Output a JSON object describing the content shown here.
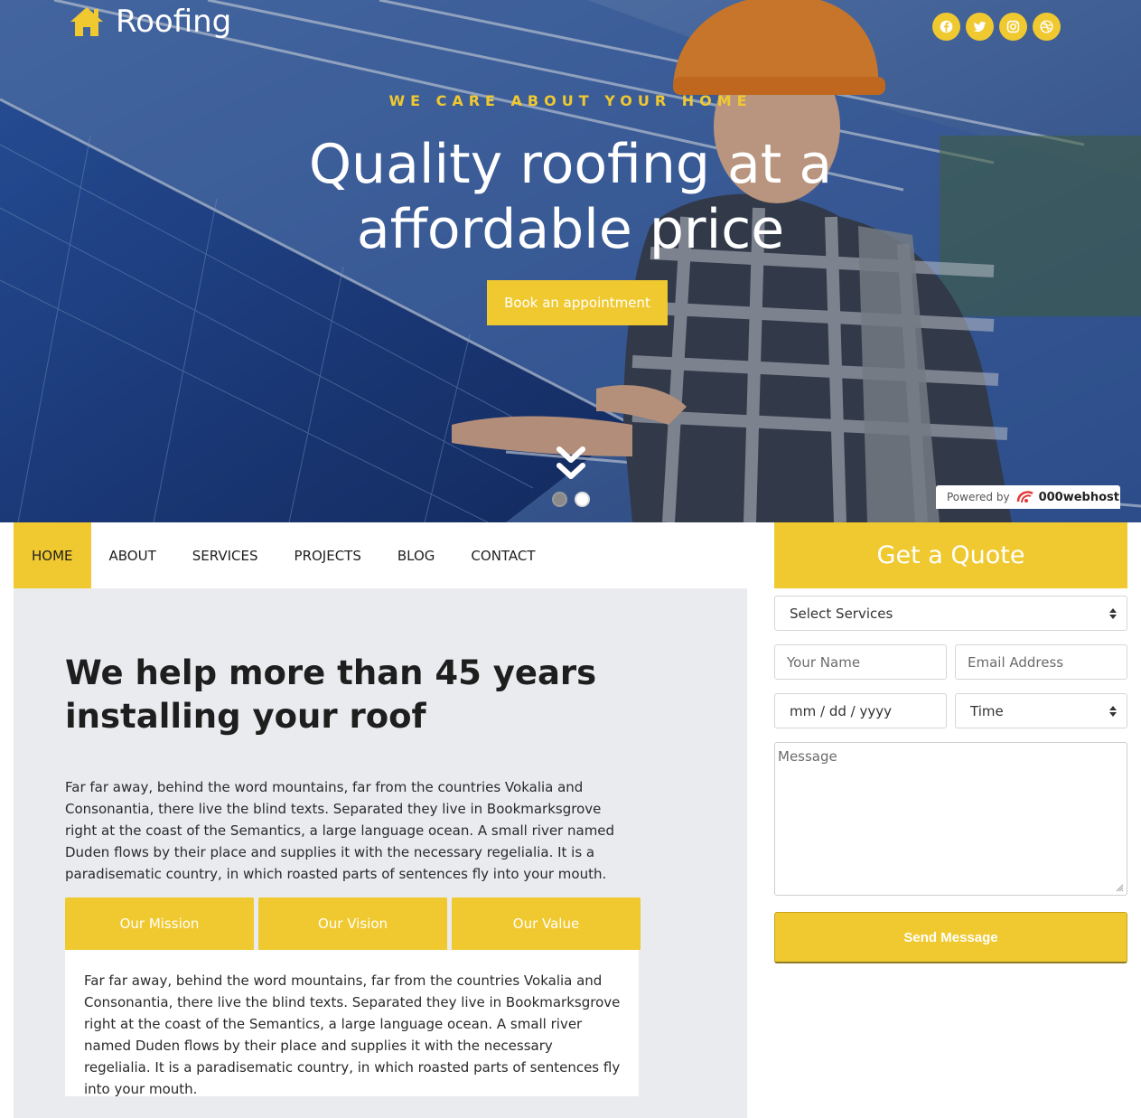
{
  "brand": {
    "name": "Roofing"
  },
  "social": [
    {
      "icon": "facebook-icon"
    },
    {
      "icon": "twitter-icon"
    },
    {
      "icon": "instagram-icon"
    },
    {
      "icon": "dribbble-icon"
    }
  ],
  "hero": {
    "kicker": "WE CARE ABOUT YOUR HOME",
    "title": "Quality roofing at a affordable price",
    "cta": "Book an appointment",
    "slides_total": 2,
    "slide_active": 2
  },
  "powered": {
    "label": "Powered by",
    "logo": "000webhost"
  },
  "nav": {
    "items": [
      {
        "label": "HOME",
        "active": true
      },
      {
        "label": "ABOUT"
      },
      {
        "label": "SERVICES"
      },
      {
        "label": "PROJECTS"
      },
      {
        "label": "BLOG"
      },
      {
        "label": "CONTACT"
      }
    ]
  },
  "about": {
    "title": "We help more than 45 years installing your roof",
    "text": "Far far away, behind the word mountains, far from the countries Vokalia and Consonantia, there live the blind texts. Separated they live in Bookmarksgrove right at the coast of the Semantics, a large language ocean. A small river named Duden flows by their place and supplies it with the necessary regelialia. It is a paradisematic country, in which roasted parts of sentences fly into your mouth.",
    "tabs": [
      {
        "label": "Our Mission"
      },
      {
        "label": "Our Vision"
      },
      {
        "label": "Our Value"
      }
    ],
    "panel_text": "Far far away, behind the word mountains, far from the countries Vokalia and Consonantia, there live the blind texts. Separated they live in Bookmarksgrove right at the coast of the Semantics, a large language ocean. A small river named Duden flows by their place and supplies it with the necessary regelialia. It is a paradisematic country, in which roasted parts of sentences fly into your mouth."
  },
  "quote": {
    "title": "Get a Quote",
    "service_select": "Select Services",
    "name_placeholder": "Your Name",
    "email_placeholder": "Email Address",
    "date_placeholder": "mm / dd / yyyy",
    "time_select": "Time",
    "message_placeholder": "Message",
    "submit": "Send Message"
  },
  "colors": {
    "accent": "#f0c930",
    "panel_bg": "#eaebef"
  }
}
